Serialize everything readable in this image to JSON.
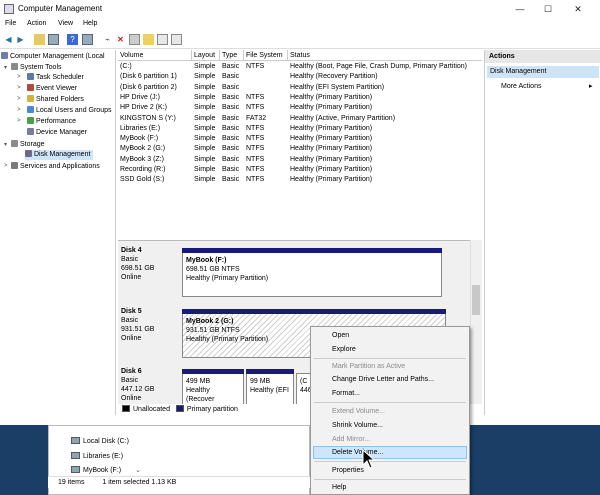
{
  "window": {
    "title": "Computer Management",
    "minimize": "—",
    "maximize": "☐",
    "close": "✕"
  },
  "menu": [
    "File",
    "Action",
    "View",
    "Help"
  ],
  "tree": [
    {
      "label": "Computer Management (Local",
      "indent": 0,
      "expander": "",
      "color": "#6b7fa8"
    },
    {
      "label": "System Tools",
      "indent": 1,
      "expander": "▾",
      "color": "#8a8a8a"
    },
    {
      "label": "Task Scheduler",
      "indent": 2,
      "expander": ">",
      "color": "#5a7aa8"
    },
    {
      "label": "Event Viewer",
      "indent": 2,
      "expander": ">",
      "color": "#b04a3a"
    },
    {
      "label": "Shared Folders",
      "indent": 2,
      "expander": ">",
      "color": "#d8b040"
    },
    {
      "label": "Local Users and Groups",
      "indent": 2,
      "expander": ">",
      "color": "#4a8ad0"
    },
    {
      "label": "Performance",
      "indent": 2,
      "expander": ">",
      "color": "#4aa04a"
    },
    {
      "label": "Device Manager",
      "indent": 2,
      "expander": "",
      "color": "#7a7a9a"
    },
    {
      "label": "Storage",
      "indent": 1,
      "expander": "▾",
      "color": "#8a8a8a"
    },
    {
      "label": "Disk Management",
      "indent": 2,
      "expander": "",
      "color": "#6a6a8a",
      "selected": true
    },
    {
      "label": "Services and Applications",
      "indent": 1,
      "expander": ">",
      "color": "#7a7a7a"
    }
  ],
  "volume_headers": [
    "Volume",
    "Layout",
    "Type",
    "File System",
    "Status"
  ],
  "volumes": [
    [
      "(C:)",
      "Simple",
      "Basic",
      "NTFS",
      "Healthy (Boot, Page File, Crash Dump, Primary Partition)"
    ],
    [
      "(Disk 6 partition 1)",
      "Simple",
      "Basic",
      "",
      "Healthy (Recovery Partition)"
    ],
    [
      "(Disk 6 partition 2)",
      "Simple",
      "Basic",
      "",
      "Healthy (EFI System Partition)"
    ],
    [
      "HP Drive (J:)",
      "Simple",
      "Basic",
      "NTFS",
      "Healthy (Primary Partition)"
    ],
    [
      "HP Drive 2 (K:)",
      "Simple",
      "Basic",
      "NTFS",
      "Healthy (Primary Partition)"
    ],
    [
      "KINGSTON S (Y:)",
      "Simple",
      "Basic",
      "FAT32",
      "Healthy (Active, Primary Partition)"
    ],
    [
      "Libraries (E:)",
      "Simple",
      "Basic",
      "NTFS",
      "Healthy (Primary Partition)"
    ],
    [
      "MyBook (F:)",
      "Simple",
      "Basic",
      "NTFS",
      "Healthy (Primary Partition)"
    ],
    [
      "MyBook 2 (G:)",
      "Simple",
      "Basic",
      "NTFS",
      "Healthy (Primary Partition)"
    ],
    [
      "MyBook 3 (Z:)",
      "Simple",
      "Basic",
      "NTFS",
      "Healthy (Primary Partition)"
    ],
    [
      "Recording (R:)",
      "Simple",
      "Basic",
      "NTFS",
      "Healthy (Primary Partition)"
    ],
    [
      "SSD Gold (S:)",
      "Simple",
      "Basic",
      "NTFS",
      "Healthy (Primary Partition)"
    ]
  ],
  "disks": {
    "d4": {
      "name": "Disk 4",
      "type": "Basic",
      "size": "698.51 GB",
      "state": "Online",
      "part": {
        "name": "MyBook  (F:)",
        "size": "698.51 GB NTFS",
        "status": "Healthy (Primary Partition)"
      }
    },
    "d5": {
      "name": "Disk 5",
      "type": "Basic",
      "size": "931.51 GB",
      "state": "Online",
      "part": {
        "name": "MyBook 2  (G:)",
        "size": "931.51 GB NTFS",
        "status": "Healthy (Primary Partition)"
      }
    },
    "d6": {
      "name": "Disk 6",
      "type": "Basic",
      "size": "447.12 GB",
      "state": "Online",
      "p1": {
        "size": "499 MB",
        "status": "Healthy (Recover"
      },
      "p2": {
        "size": "99 MB",
        "status": "Healthy (EFI"
      },
      "p3": {
        "name": "(C",
        "size": "446"
      }
    }
  },
  "legend": {
    "unallocated": "Unallocated",
    "primary": "Primary partition"
  },
  "actions": {
    "header": "Actions",
    "section": "Disk Management",
    "more": "More Actions",
    "arrow": "▸"
  },
  "explorer": {
    "items": [
      "Local Disk (C:)",
      "Libraries (E:)",
      "MyBook (F:)"
    ],
    "status_count": "19 items",
    "status_selected": "1 item selected  1.13 KB"
  },
  "context_menu": {
    "open": "Open",
    "explore": "Explore",
    "mark_active": "Mark Partition as Active",
    "change_letter": "Change Drive Letter and Paths...",
    "format": "Format...",
    "extend": "Extend Volume...",
    "shrink": "Shrink Volume...",
    "mirror": "Add Mirror...",
    "delete": "Delete Volume...",
    "properties": "Properties",
    "help": "Help"
  },
  "colors": {
    "primary_partition": "#1a1a7a",
    "selection": "#cde6fb",
    "taskbar": "#1a3e66"
  }
}
